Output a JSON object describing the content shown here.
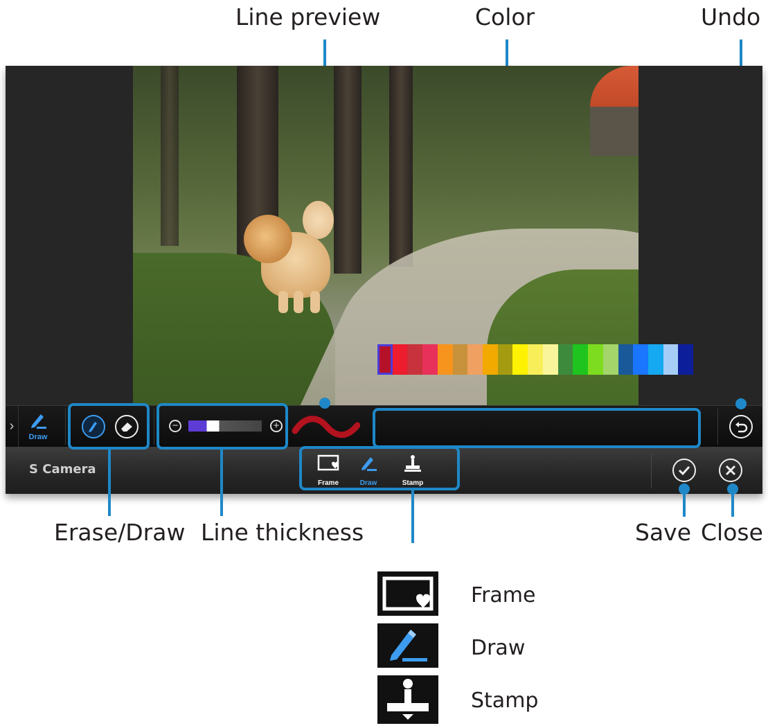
{
  "callouts": {
    "line_preview": "Line preview",
    "color": "Color",
    "undo": "Undo",
    "erase_draw": "Erase/Draw",
    "line_thickness": "Line thickness",
    "save": "Save",
    "close": "Close"
  },
  "toolbar": {
    "chevron": "›",
    "draw_tab_label": "Draw",
    "thickness_minus": "−",
    "thickness_plus": "+",
    "thickness_level": 0.35,
    "palette_colors": [
      "#b5122a",
      "#ed1c2e",
      "#c8323c",
      "#e8315a",
      "#f7941d",
      "#c8923c",
      "#f0a060",
      "#f2a900",
      "#a59b10",
      "#fff200",
      "#f7ee5a",
      "#f9f59a",
      "#3d8a3d",
      "#1fc41f",
      "#7ddc1f",
      "#a3d56a",
      "#19599a",
      "#1a75ff",
      "#14a9f0",
      "#a6cdf7",
      "#0d1e9a"
    ],
    "selected_color_index": 0
  },
  "bottombar": {
    "app_name": "S Camera",
    "tabs": [
      {
        "label": "Frame"
      },
      {
        "label": "Draw"
      },
      {
        "label": "Stamp"
      }
    ]
  },
  "legend": [
    {
      "label": "Frame"
    },
    {
      "label": "Draw"
    },
    {
      "label": "Stamp"
    }
  ],
  "colors": {
    "accent": "#1e88c8",
    "draw_blue": "#3d9cf0",
    "line_preview": "#b3121f"
  }
}
